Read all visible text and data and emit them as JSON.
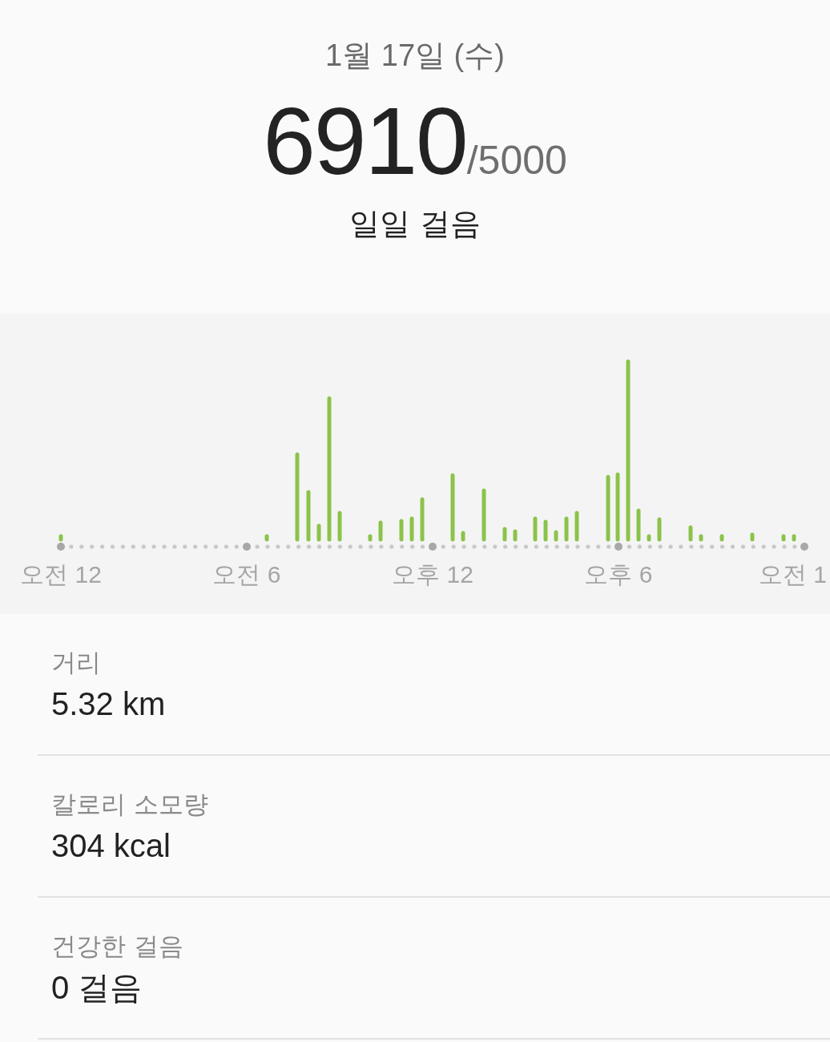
{
  "header": {
    "date": "1월 17일 (수)",
    "steps": "6910",
    "goal": "/5000",
    "label": "일일 걸음"
  },
  "chart": {
    "x_labels": [
      "오전 12",
      "오전 6",
      "오후 12",
      "오후 6",
      "오전 1"
    ]
  },
  "stats": [
    {
      "label": "거리",
      "value": "5.32 km"
    },
    {
      "label": "칼로리 소모량",
      "value": "304 kcal"
    },
    {
      "label": "건강한 걸음",
      "value": "0 걸음"
    }
  ]
}
